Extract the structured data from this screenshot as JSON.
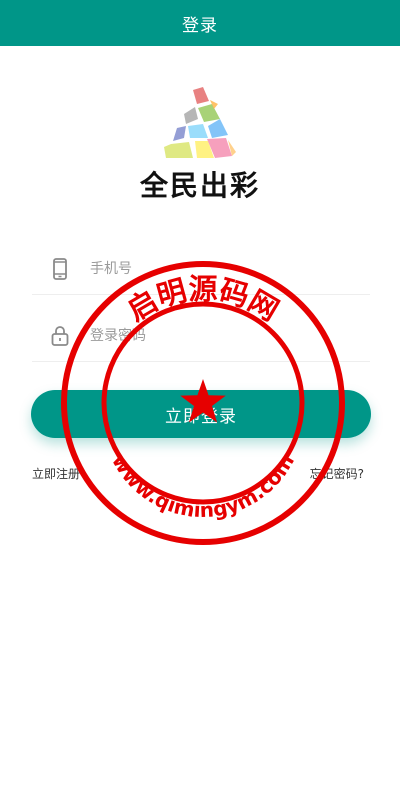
{
  "header": {
    "title": "登录"
  },
  "brand": {
    "name": "全民出彩"
  },
  "form": {
    "phone_placeholder": "手机号",
    "password_placeholder": "登录密码",
    "login_button": "立即登录"
  },
  "links": {
    "register": "立即注册",
    "forgot_password": "忘记密码?"
  },
  "watermark": {
    "top_text": "启明源码网",
    "bottom_text": "www.qimingym.com"
  },
  "colors": {
    "primary": "#009688",
    "stamp": "#e60000"
  },
  "icons": {
    "phone": "mobile-phone-icon",
    "password": "lock-icon"
  }
}
